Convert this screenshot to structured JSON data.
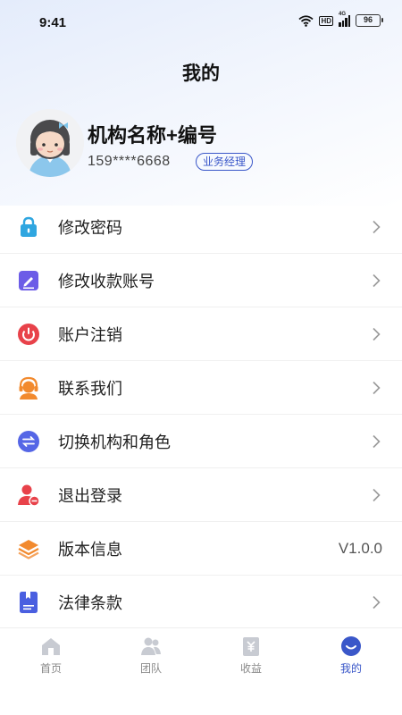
{
  "status_bar": {
    "time": "9:41",
    "network_label": "4G",
    "hd_label": "HD",
    "battery": "96"
  },
  "page": {
    "title": "我的"
  },
  "profile": {
    "org_name": "机构名称+编号",
    "phone": "159****6668",
    "role": "业务经理",
    "avatar_icon": "girl-avatar"
  },
  "menu": [
    {
      "label": "修改密码",
      "icon": "lock-icon",
      "color": "#2fa6e0",
      "has_chevron": true
    },
    {
      "label": "修改收款账号",
      "icon": "edit-icon",
      "color": "#6c5ce7",
      "has_chevron": true
    },
    {
      "label": "账户注销",
      "icon": "power-icon",
      "color": "#e8424a",
      "has_chevron": true
    },
    {
      "label": "联系我们",
      "icon": "headset-icon",
      "color": "#f28a2e",
      "has_chevron": true
    },
    {
      "label": "切换机构和角色",
      "icon": "swap-icon",
      "color": "#5566e6",
      "has_chevron": true
    },
    {
      "label": "退出登录",
      "icon": "logout-user-icon",
      "color": "#e8424a",
      "has_chevron": true
    },
    {
      "label": "版本信息",
      "icon": "layers-icon",
      "color": "#f28a2e",
      "has_chevron": false,
      "value": "V1.0.0"
    },
    {
      "label": "法律条款",
      "icon": "document-icon",
      "color": "#4a5fe0",
      "has_chevron": true
    }
  ],
  "tabbar": {
    "tabs": [
      {
        "label": "首页",
        "icon": "home-icon",
        "active": false
      },
      {
        "label": "团队",
        "icon": "team-icon",
        "active": false
      },
      {
        "label": "收益",
        "icon": "income-icon",
        "active": false
      },
      {
        "label": "我的",
        "icon": "profile-icon",
        "active": true
      }
    ]
  },
  "colors": {
    "accent": "#3a57c9",
    "inactive": "#c8cbd2"
  }
}
